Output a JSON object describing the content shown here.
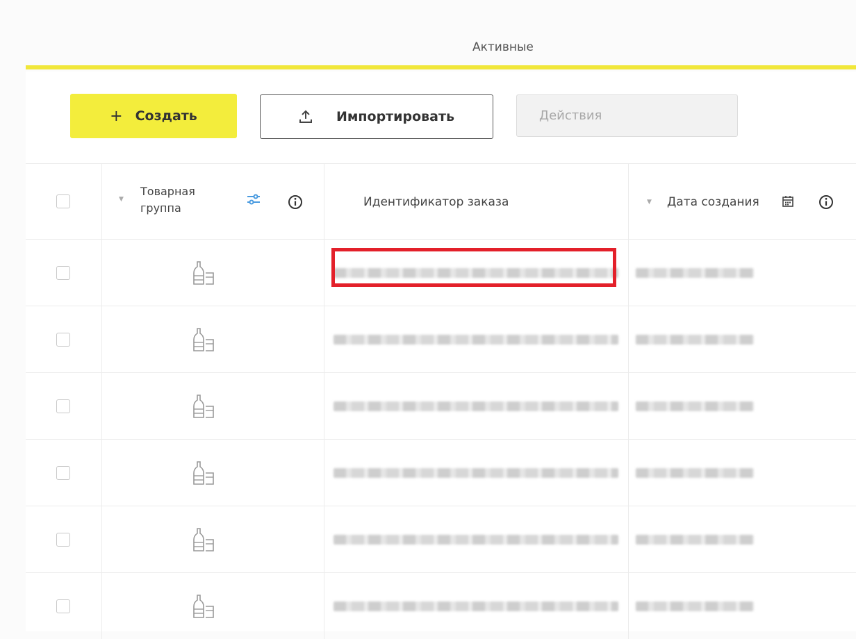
{
  "tabs": {
    "active_label": "Активные"
  },
  "toolbar": {
    "create_label": "Создать",
    "create_plus": "+",
    "import_label": "Импортировать",
    "actions_placeholder": "Действия"
  },
  "table": {
    "columns": {
      "product_group": "Товарная группа",
      "order_id": "Идентификатор заказа",
      "created_date": "Дата создания"
    },
    "row_count": 6
  },
  "colors": {
    "accent_yellow": "#f3ed3c",
    "highlight_red": "#e3202a"
  }
}
